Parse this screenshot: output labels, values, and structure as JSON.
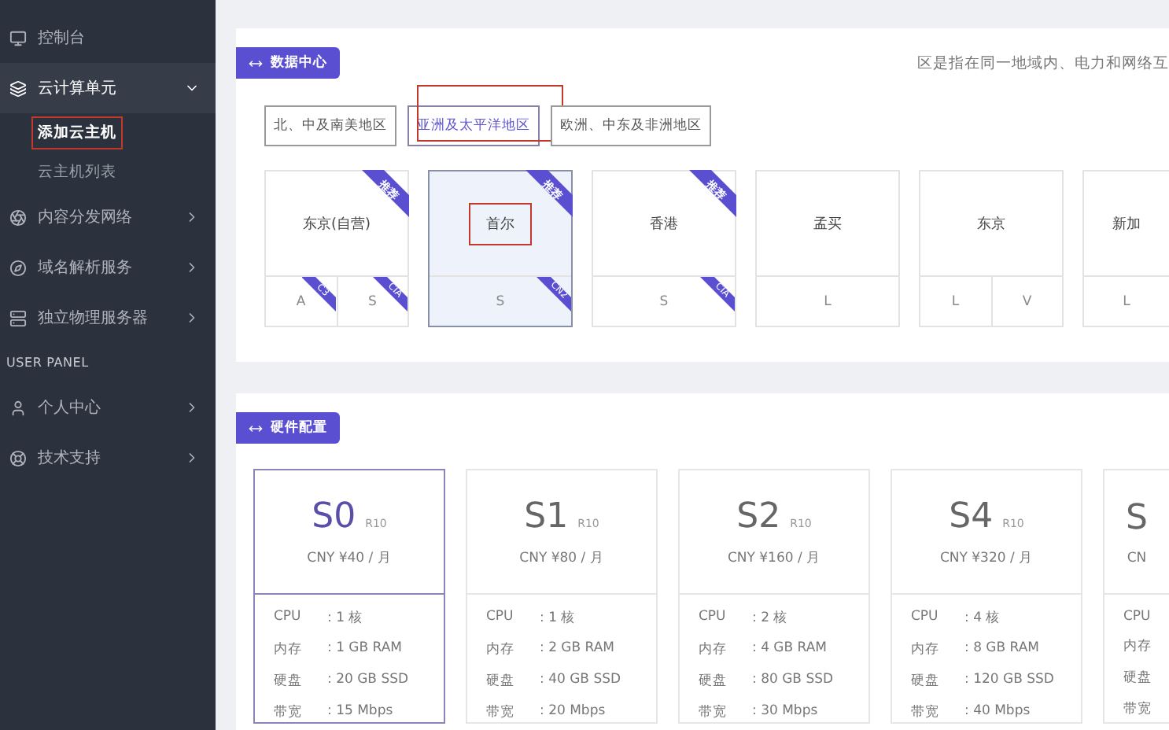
{
  "sidebar": {
    "items": [
      {
        "label": "控制台",
        "kind": "link",
        "expanded": false
      },
      {
        "label": "云计算单元",
        "kind": "group",
        "expanded": true,
        "children": [
          {
            "label": "添加云主机",
            "selected": true,
            "annotated": true
          },
          {
            "label": "云主机列表",
            "selected": false,
            "annotated": false
          }
        ]
      },
      {
        "label": "内容分发网络",
        "kind": "group",
        "expanded": false
      },
      {
        "label": "域名解析服务",
        "kind": "group",
        "expanded": false
      },
      {
        "label": "独立物理服务器",
        "kind": "group",
        "expanded": false
      },
      {
        "label": "USER PANEL",
        "kind": "section"
      },
      {
        "label": "个人中心",
        "kind": "group",
        "expanded": false
      },
      {
        "label": "技术支持",
        "kind": "group",
        "expanded": false
      }
    ]
  },
  "datacenter": {
    "badge": "数据中心",
    "description": "区是指在同一地域内、电力和网络互",
    "regions": [
      {
        "label": "北、中及南美地区",
        "selected": false,
        "annotated": false
      },
      {
        "label": "亚洲及太平洋地区",
        "selected": true,
        "annotated": true
      },
      {
        "label": "欧洲、中东及非洲地区",
        "selected": false,
        "annotated": false
      }
    ],
    "locations": [
      {
        "name": "东京(自营)",
        "selected": false,
        "annotated": false,
        "ribbon": "推荐",
        "cells": [
          {
            "label": "A",
            "tag": "C3"
          },
          {
            "label": "S",
            "tag": "CIA"
          }
        ]
      },
      {
        "name": "首尔",
        "selected": true,
        "annotated": true,
        "ribbon": "推荐",
        "cells": [
          {
            "label": "S",
            "tag": "CN2"
          }
        ]
      },
      {
        "name": "香港",
        "selected": false,
        "annotated": false,
        "ribbon": "推荐",
        "cells": [
          {
            "label": "S",
            "tag": "CIA"
          }
        ]
      },
      {
        "name": "孟买",
        "selected": false,
        "annotated": false,
        "cells": [
          {
            "label": "L"
          }
        ]
      },
      {
        "name": "东京",
        "selected": false,
        "annotated": false,
        "cells": [
          {
            "label": "L"
          },
          {
            "label": "V"
          }
        ]
      },
      {
        "name": "新加",
        "selected": false,
        "annotated": false,
        "cells": [
          {
            "label": "L"
          }
        ]
      }
    ]
  },
  "hardware": {
    "badge": "硬件配置",
    "plans": [
      {
        "name": "S0",
        "suffix": "R10",
        "price": "CNY ¥40 / 月",
        "selected": true,
        "specs": [
          {
            "label": "CPU",
            "value": ": 1 核"
          },
          {
            "label": "内存",
            "value": ": 1 GB RAM"
          },
          {
            "label": "硬盘",
            "value": ": 20 GB SSD"
          },
          {
            "label": "带宽",
            "value": ": 15 Mbps"
          }
        ]
      },
      {
        "name": "S1",
        "suffix": "R10",
        "price": "CNY ¥80 / 月",
        "selected": false,
        "specs": [
          {
            "label": "CPU",
            "value": ": 1 核"
          },
          {
            "label": "内存",
            "value": ": 2 GB RAM"
          },
          {
            "label": "硬盘",
            "value": ": 40 GB SSD"
          },
          {
            "label": "带宽",
            "value": ": 20 Mbps"
          }
        ]
      },
      {
        "name": "S2",
        "suffix": "R10",
        "price": "CNY ¥160 / 月",
        "selected": false,
        "specs": [
          {
            "label": "CPU",
            "value": ": 2 核"
          },
          {
            "label": "内存",
            "value": ": 4 GB RAM"
          },
          {
            "label": "硬盘",
            "value": ": 80 GB SSD"
          },
          {
            "label": "带宽",
            "value": ": 30 Mbps"
          }
        ]
      },
      {
        "name": "S4",
        "suffix": "R10",
        "price": "CNY ¥320 / 月",
        "selected": false,
        "specs": [
          {
            "label": "CPU",
            "value": ": 4 核"
          },
          {
            "label": "内存",
            "value": ": 8 GB RAM"
          },
          {
            "label": "硬盘",
            "value": ": 120 GB SSD"
          },
          {
            "label": "带宽",
            "value": ": 40 Mbps"
          }
        ]
      },
      {
        "name": "S",
        "price": "CN",
        "selected": false,
        "specs": [
          {
            "label": "CPU"
          },
          {
            "label": "内存"
          },
          {
            "label": "硬盘"
          },
          {
            "label": "带宽"
          }
        ]
      }
    ]
  }
}
